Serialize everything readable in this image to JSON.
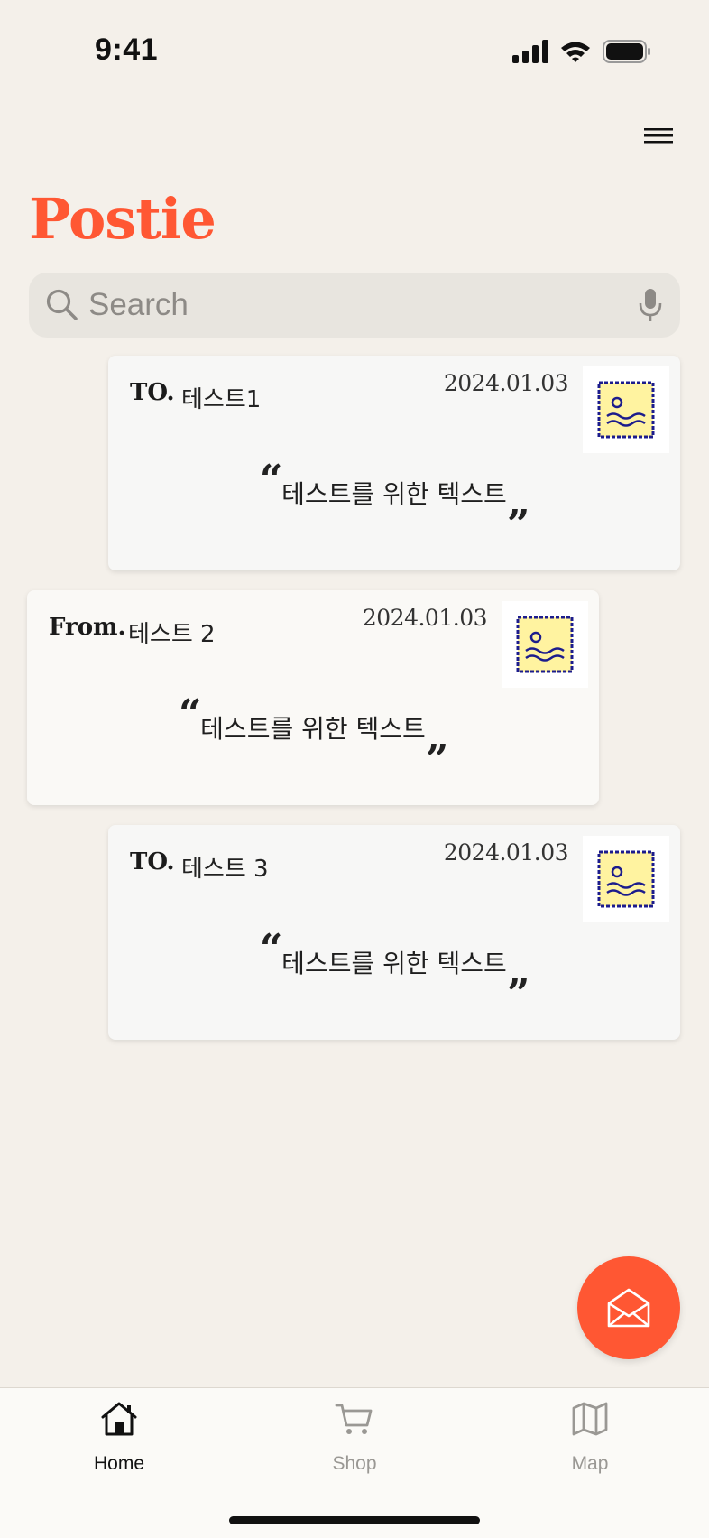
{
  "status_bar": {
    "time": "9:41"
  },
  "header": {
    "title": "Postie",
    "menu_icon": "hamburger-menu-icon"
  },
  "search": {
    "placeholder": "Search",
    "value": ""
  },
  "cards": [
    {
      "prefix": "TO.",
      "name": "테스트1",
      "date": "2024.01.03",
      "message": "테스트를 위한 텍스트",
      "quote_open": "“",
      "quote_close": "”"
    },
    {
      "prefix": "From.",
      "name": "테스트 2",
      "date": "2024.01.03",
      "message": "테스트를 위한 텍스트",
      "quote_open": "“",
      "quote_close": "”"
    },
    {
      "prefix": "TO.",
      "name": "테스트 3",
      "date": "2024.01.03",
      "message": "테스트를 위한 텍스트",
      "quote_open": "“",
      "quote_close": "”"
    }
  ],
  "fab": {
    "icon": "open-envelope-icon"
  },
  "tabs": [
    {
      "label": "Home",
      "icon": "home-icon",
      "active": true
    },
    {
      "label": "Shop",
      "icon": "cart-icon",
      "active": false
    },
    {
      "label": "Map",
      "icon": "map-icon",
      "active": false
    }
  ],
  "colors": {
    "accent": "#ff5733",
    "background": "#f4f0ea",
    "stamp_border": "#1c1c8c",
    "stamp_fill": "#fff3a0"
  }
}
